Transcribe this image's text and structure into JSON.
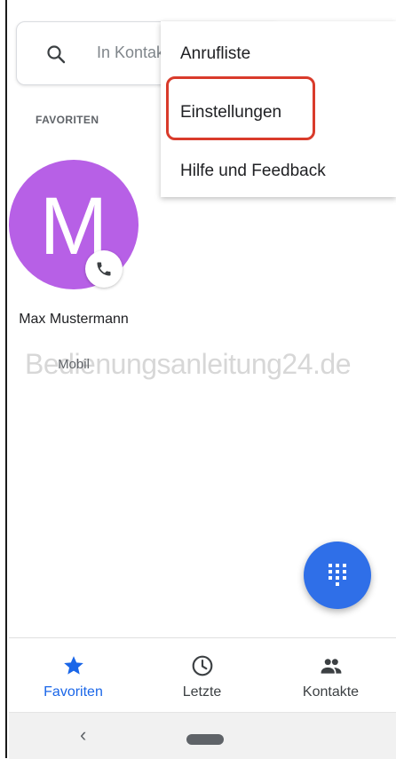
{
  "search": {
    "placeholder": "In Kontakten suchen"
  },
  "favorites": {
    "section_label": "FAVORITEN",
    "contact": {
      "initial": "M",
      "name": "Max Mustermann",
      "type": "Mobil",
      "avatar_color": "#b760e6"
    }
  },
  "watermark": "Bedienungsanleitung24.de",
  "overflow_menu": {
    "items": [
      {
        "label": "Anrufliste"
      },
      {
        "label": "Einstellungen"
      },
      {
        "label": "Hilfe und Feedback"
      }
    ],
    "highlighted_item": "Einstellungen",
    "highlight_color": "#d93b2b"
  },
  "fab": {
    "icon": "dialpad-icon",
    "color": "#2f6fe8"
  },
  "bottom_nav": {
    "items": [
      {
        "label": "Favoriten",
        "icon": "star-icon",
        "active": true
      },
      {
        "label": "Letzte",
        "icon": "clock-icon",
        "active": false
      },
      {
        "label": "Kontakte",
        "icon": "people-icon",
        "active": false
      }
    ],
    "active_color": "#1a66e8"
  },
  "system_nav": {
    "back_glyph": "‹"
  }
}
